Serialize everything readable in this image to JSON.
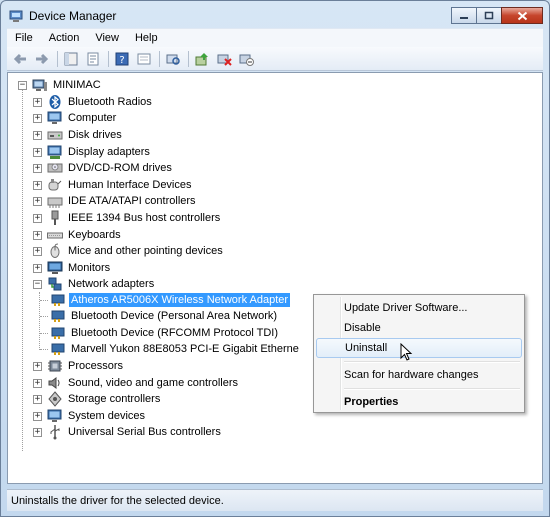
{
  "window": {
    "title": "Device Manager",
    "icon": "device-manager-icon"
  },
  "menu": [
    "File",
    "Action",
    "View",
    "Help"
  ],
  "toolbar": {
    "buttons": [
      "back-arrow-icon",
      "forward-arrow-icon",
      "show-hide-tree-icon",
      "properties-icon",
      "help-icon",
      "view-icon",
      "scan-hardware-icon",
      "update-driver-icon",
      "uninstall-icon",
      "disable-icon"
    ]
  },
  "tree": {
    "root": "MINIMAC",
    "categories": [
      "Bluetooth Radios",
      "Computer",
      "Disk drives",
      "Display adapters",
      "DVD/CD-ROM drives",
      "Human Interface Devices",
      "IDE ATA/ATAPI controllers",
      "IEEE 1394 Bus host controllers",
      "Keyboards",
      "Mice and other pointing devices",
      "Monitors",
      "Network adapters",
      "Processors",
      "Sound, video and game controllers",
      "Storage controllers",
      "System devices",
      "Universal Serial Bus controllers"
    ],
    "network_devices": [
      "Atheros AR5006X Wireless Network Adapter",
      "Bluetooth Device (Personal Area Network)",
      "Bluetooth Device (RFCOMM Protocol TDI)",
      "Marvell Yukon 88E8053 PCI-E Gigabit Etherne"
    ]
  },
  "context_menu": {
    "items": [
      "Update Driver Software...",
      "Disable",
      "Uninstall",
      "Scan for hardware changes",
      "Properties"
    ],
    "hovered": "Uninstall"
  },
  "status": "Uninstalls the driver for the selected device."
}
